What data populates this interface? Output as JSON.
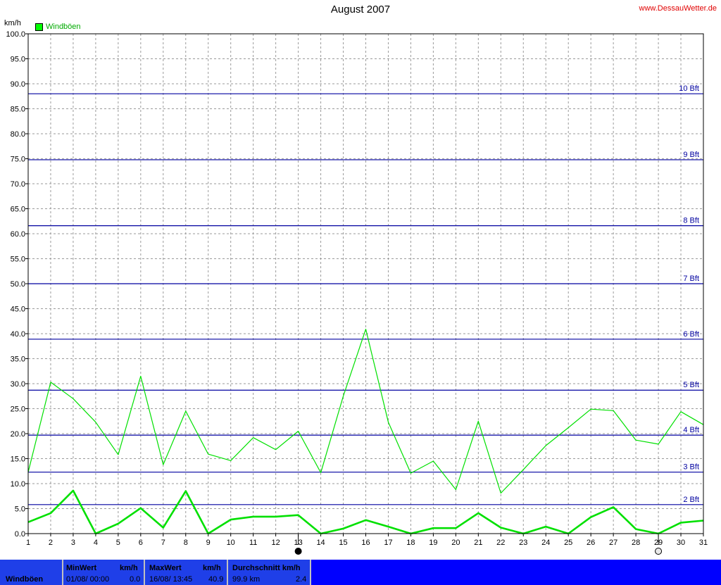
{
  "header": {
    "title": "August 2007",
    "site": "www.DessauWetter.de",
    "unit": "km/h",
    "legend": "Windböen"
  },
  "colors": {
    "series": "#00e000",
    "grid": "#9a9a9a",
    "beaufort": "#0000a0",
    "footer": "#0000ff"
  },
  "chart_data": {
    "type": "line",
    "title": "August 2007",
    "ylabel": "km/h",
    "ylim": [
      0,
      100
    ],
    "xlim": [
      1,
      31
    ],
    "yticks": [
      "0.0",
      "5.0",
      "10.0",
      "15.0",
      "20.0",
      "25.0",
      "30.0",
      "35.0",
      "40.0",
      "45.0",
      "50.0",
      "55.0",
      "60.0",
      "65.0",
      "70.0",
      "75.0",
      "80.0",
      "85.0",
      "90.0",
      "95.0",
      "100.0"
    ],
    "x": [
      1,
      2,
      3,
      4,
      5,
      6,
      7,
      8,
      9,
      10,
      11,
      12,
      13,
      14,
      15,
      16,
      17,
      18,
      19,
      20,
      21,
      22,
      23,
      24,
      25,
      26,
      27,
      28,
      29,
      30,
      31
    ],
    "series": [
      {
        "name": "Windböen",
        "values": [
          12.3,
          30.3,
          27,
          22.3,
          15.8,
          31.5,
          13.8,
          24.5,
          15.9,
          14.6,
          19.2,
          16.8,
          20.5,
          12.2,
          27.5,
          40.9,
          22.3,
          12.1,
          14.5,
          8.8,
          22.5,
          8.1,
          12.8,
          17.6,
          21.2,
          24.9,
          24.6,
          18.7,
          17.9,
          24.4,
          21.8
        ]
      },
      {
        "name": "",
        "values": [
          2.3,
          4.1,
          8.6,
          0,
          2,
          5.1,
          1.2,
          8.5,
          0,
          2.8,
          3.4,
          3.4,
          3.7,
          0,
          1,
          2.7,
          1.4,
          0,
          1.1,
          1.1,
          4.1,
          1.2,
          0,
          1.4,
          0,
          3.3,
          5.3,
          0.9,
          0,
          2.2,
          2.6
        ]
      }
    ],
    "beaufort": [
      {
        "label": "2 Bft",
        "value": 5.8
      },
      {
        "label": "3 Bft",
        "value": 12.3
      },
      {
        "label": "4 Bft",
        "value": 19.7
      },
      {
        "label": "5 Bft",
        "value": 28.7
      },
      {
        "label": "6 Bft",
        "value": 38.9
      },
      {
        "label": "7 Bft",
        "value": 50.0
      },
      {
        "label": "8 Bft",
        "value": 61.6
      },
      {
        "label": "9 Bft",
        "value": 74.8
      },
      {
        "label": "10 Bft",
        "value": 88.0
      }
    ],
    "markers": [
      {
        "day": 13,
        "type": "new-moon"
      },
      {
        "day": 29,
        "type": "full-moon"
      }
    ],
    "grid": true,
    "legend": "top-left"
  },
  "footer": {
    "label": "Windböen",
    "min": {
      "header": "MinWert",
      "unit": "km/h",
      "date": "01/08/  00:00",
      "value": "0.0"
    },
    "max": {
      "header": "MaxWert",
      "unit": "km/h",
      "date": "16/08/  13:45",
      "value": "40.9"
    },
    "avg": {
      "header": "Durchschnitt km/h",
      "dist": "99.9 km",
      "value": "2.4"
    }
  }
}
